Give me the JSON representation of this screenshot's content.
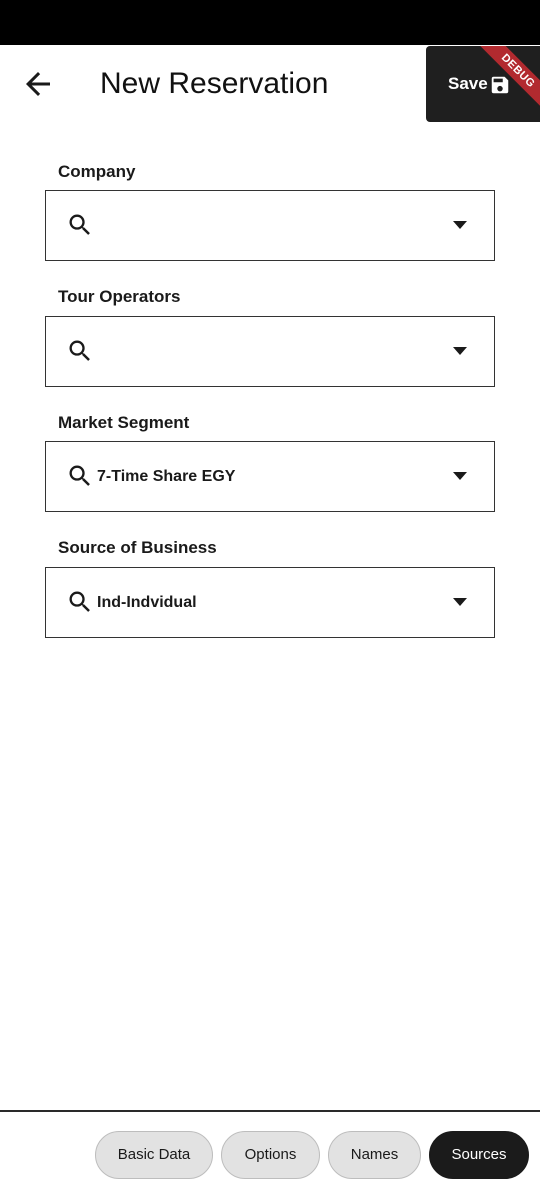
{
  "header": {
    "title": "New Reservation",
    "save_label": "Save",
    "debug_banner": "DEBUG"
  },
  "fields": [
    {
      "label": "Company",
      "value": ""
    },
    {
      "label": "Tour Operators",
      "value": ""
    },
    {
      "label": "Market Segment",
      "value": "7-Time Share EGY"
    },
    {
      "label": "Source of Business",
      "value": "Ind-Indvidual"
    }
  ],
  "tabs": [
    {
      "label": "Basic Data",
      "active": false
    },
    {
      "label": "Options",
      "active": false
    },
    {
      "label": "Names",
      "active": false
    },
    {
      "label": "Sources",
      "active": true
    }
  ],
  "colors": {
    "status_bar": "#000000",
    "save_button": "#1f1f1f",
    "debug_ribbon": "#b22a2f",
    "tab_inactive": "#e2e2e2",
    "tab_active": "#1b1b1b"
  },
  "icons": {
    "back": "arrow-left-icon",
    "save": "floppy-disk-icon",
    "search": "search-icon",
    "dropdown": "triangle-down-icon"
  }
}
